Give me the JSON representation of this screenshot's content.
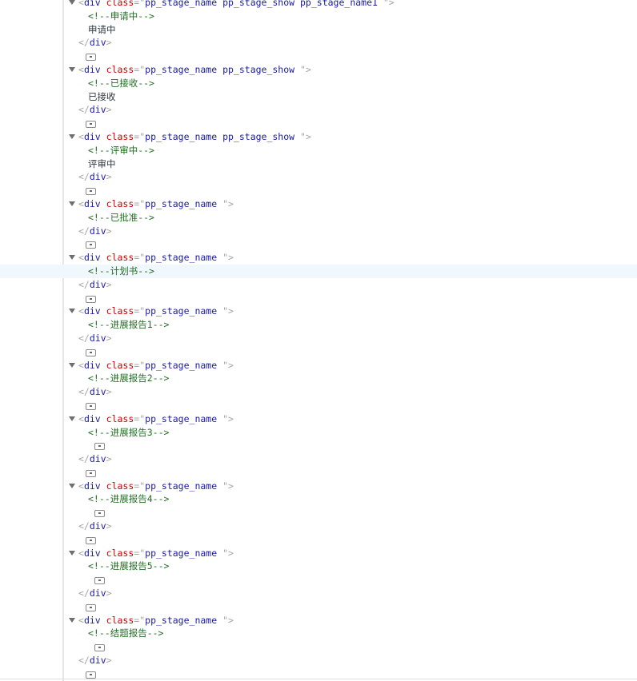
{
  "rows": [
    {
      "t": "open",
      "cls": "pp_stage_name pp_stage_show pp_stage_name1 "
    },
    {
      "t": "comment",
      "text": "申请中"
    },
    {
      "t": "text",
      "text": "申请中"
    },
    {
      "t": "close"
    },
    {
      "t": "badge",
      "d": 1
    },
    {
      "t": "open",
      "cls": "pp_stage_name pp_stage_show "
    },
    {
      "t": "comment",
      "text": "已接收"
    },
    {
      "t": "text",
      "text": "已接收"
    },
    {
      "t": "close"
    },
    {
      "t": "badge",
      "d": 1
    },
    {
      "t": "open",
      "cls": "pp_stage_name pp_stage_show "
    },
    {
      "t": "comment",
      "text": "评审中"
    },
    {
      "t": "text",
      "text": "评审中"
    },
    {
      "t": "close"
    },
    {
      "t": "badge",
      "d": 1
    },
    {
      "t": "open",
      "cls": "pp_stage_name "
    },
    {
      "t": "comment",
      "text": "已批准"
    },
    {
      "t": "close"
    },
    {
      "t": "badge",
      "d": 1
    },
    {
      "t": "open",
      "cls": "pp_stage_name "
    },
    {
      "t": "comment",
      "text": "计划书",
      "hl": true
    },
    {
      "t": "close"
    },
    {
      "t": "badge",
      "d": 1
    },
    {
      "t": "open",
      "cls": "pp_stage_name "
    },
    {
      "t": "comment",
      "text": "进展报告1"
    },
    {
      "t": "close"
    },
    {
      "t": "badge",
      "d": 1
    },
    {
      "t": "open",
      "cls": "pp_stage_name "
    },
    {
      "t": "comment",
      "text": "进展报告2"
    },
    {
      "t": "close"
    },
    {
      "t": "badge",
      "d": 1
    },
    {
      "t": "open",
      "cls": "pp_stage_name "
    },
    {
      "t": "comment",
      "text": "进展报告3"
    },
    {
      "t": "badge",
      "d": 2
    },
    {
      "t": "close"
    },
    {
      "t": "badge",
      "d": 1
    },
    {
      "t": "open",
      "cls": "pp_stage_name "
    },
    {
      "t": "comment",
      "text": "进展报告4"
    },
    {
      "t": "badge",
      "d": 2
    },
    {
      "t": "close"
    },
    {
      "t": "badge",
      "d": 1
    },
    {
      "t": "open",
      "cls": "pp_stage_name "
    },
    {
      "t": "comment",
      "text": "进展报告5"
    },
    {
      "t": "badge",
      "d": 2
    },
    {
      "t": "close"
    },
    {
      "t": "badge",
      "d": 1
    },
    {
      "t": "open",
      "cls": "pp_stage_name "
    },
    {
      "t": "comment",
      "text": "结题报告"
    },
    {
      "t": "badge",
      "d": 2
    },
    {
      "t": "close"
    },
    {
      "t": "badge",
      "d": 1
    }
  ],
  "tag_name": "div",
  "attr_name": "class"
}
